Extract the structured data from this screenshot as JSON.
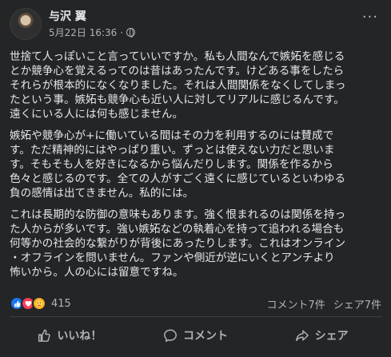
{
  "post": {
    "author": "与沢 翼",
    "date": "5月22日 16:36",
    "privacy_icon": "globe-icon",
    "more_label": "···",
    "paragraphs": [
      "世捨て人っぽいこと言っていいですか。私も人間なんで嫉妬を感じる\nとか競争心を覚えるってのは昔はあったんです。けどある事をしたら\nそれらが根本的になくなりました。それは人間関係をなくしてしまっ\nたという事。嫉妬も競争心も近い人に対してリアルに感じるんです。\n遠くにいる人には何も感じません。",
      "嫉妬や競争心が+に働いている間はその力を利用するのには賛成で\nす。ただ精神的にはやっぱり重い。ずっとは使えない力だと思いま\nす。そもそも人を好きになるから悩んだりします。関係を作るから\n色々と感じるのです。全ての人がすごく遠くに感じているといわゆる\n負の感情は出てきません。私的には。",
      "これは長期的な防御の意味もあります。強く恨まれるのは関係を持っ\nた人からが多いです。強い嫉妬などの執着心を持って追われる場合も\n何等かの社会的な繋がりが背後にあったりします。これはオンライン\n・オフラインを問いません。ファンや側近が逆にいくとアンチより\n怖いから。人の心には留意ですね。"
    ]
  },
  "stats": {
    "reaction_icons": [
      "like-icon",
      "love-icon",
      "care-icon"
    ],
    "reaction_count": "415",
    "comments": "コメント7件",
    "shares": "シェア7件"
  },
  "actions": {
    "like": "いいね！",
    "comment": "コメント",
    "share": "シェア"
  }
}
